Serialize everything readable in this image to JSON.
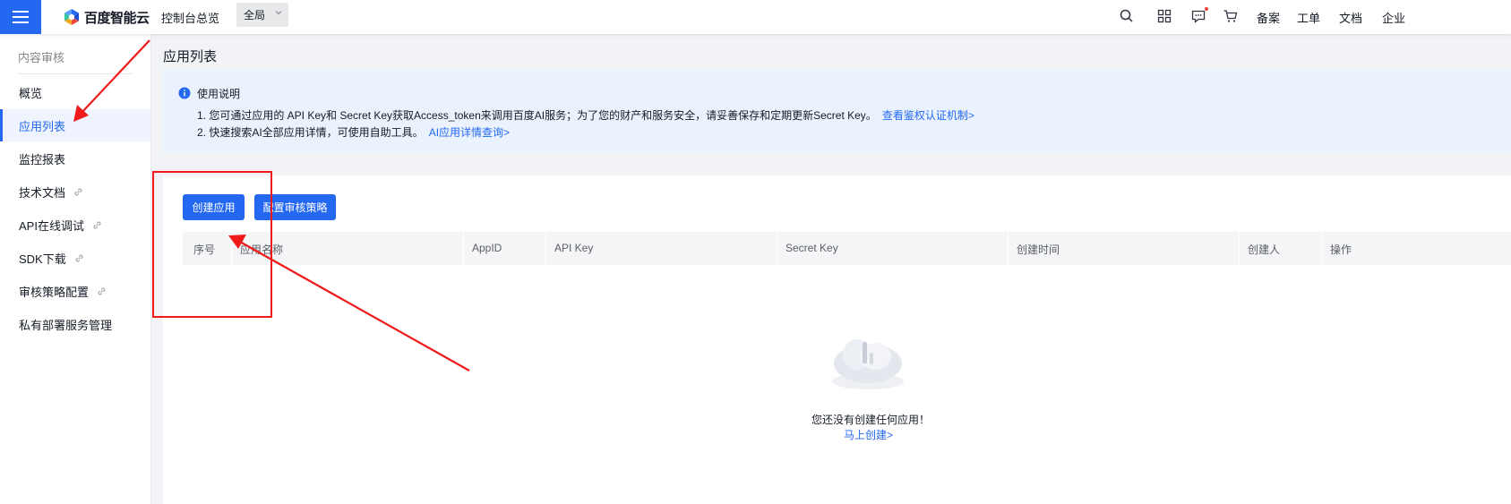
{
  "colors": {
    "primary": "#2468f2",
    "annotation": "#f01a1a"
  },
  "topbar": {
    "brand": "百度智能云",
    "console": "控制台总览",
    "region": "全局",
    "icons": [
      "search-icon",
      "apps-grid-icon",
      "message-icon",
      "cart-icon"
    ],
    "links": [
      "备案",
      "工单",
      "文档",
      "企业"
    ]
  },
  "sidebar": {
    "section_title": "内容审核",
    "items": [
      {
        "label": "概览",
        "external": false
      },
      {
        "label": "应用列表",
        "external": false,
        "active": true
      },
      {
        "label": "监控报表",
        "external": false
      },
      {
        "label": "技术文档",
        "external": true
      },
      {
        "label": "API在线调试",
        "external": true
      },
      {
        "label": "SDK下载",
        "external": true
      },
      {
        "label": "审核策略配置",
        "external": true
      },
      {
        "label": "私有部署服务管理",
        "external": false
      }
    ]
  },
  "page": {
    "title": "应用列表"
  },
  "notice": {
    "title": "使用说明",
    "line1": "1. 您可通过应用的 API Key和 Secret Key获取Access_token来调用百度AI服务；为了您的财产和服务安全，请妥善保存和定期更新Secret Key。",
    "line1_link": "查看鉴权认证机制>",
    "line2": "2. 快速搜索AI全部应用详情，可使用自助工具。",
    "line2_link": "AI应用详情查询>"
  },
  "actions": {
    "create": "创建应用",
    "policy": "配置审核策略"
  },
  "table": {
    "columns": [
      "序号",
      "应用名称",
      "AppID",
      "API Key",
      "Secret Key",
      "创建时间",
      "创建人",
      "操作"
    ]
  },
  "empty": {
    "text": "您还没有创建任何应用！",
    "link": "马上创建>"
  }
}
